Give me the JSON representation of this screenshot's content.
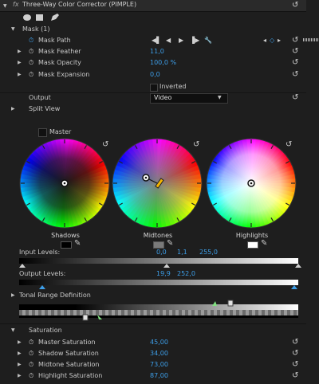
{
  "effect": {
    "fx_label": "fx",
    "title": "Three-Way Color Corrector (PIMPLE)"
  },
  "mask": {
    "group_label": "Mask (1)",
    "path_label": "Mask Path",
    "feather_label": "Mask Feather",
    "feather_value": "11,0",
    "opacity_label": "Mask Opacity",
    "opacity_value": "100,0 %",
    "expansion_label": "Mask Expansion",
    "expansion_value": "0,0",
    "inverted_label": "Inverted"
  },
  "output": {
    "label": "Output",
    "selected": "Video"
  },
  "split_view_label": "Split View",
  "master_label": "Master",
  "wheels": {
    "shadows_label": "Shadows",
    "midtones_label": "Midtones",
    "highlights_label": "Highlights"
  },
  "input_levels": {
    "label": "Input Levels:",
    "black": "0,0",
    "gray": "1,1",
    "white": "255,0"
  },
  "output_levels": {
    "label": "Output Levels:",
    "black": "19,9",
    "white": "252,0"
  },
  "tonal_label": "Tonal Range Definition",
  "saturation": {
    "group_label": "Saturation",
    "master_label": "Master Saturation",
    "master_value": "45,00",
    "shadow_label": "Shadow Saturation",
    "shadow_value": "34,00",
    "midtone_label": "Midtone Saturation",
    "midtone_value": "73,00",
    "highlight_label": "Highlight Saturation",
    "highlight_value": "87,00"
  },
  "colors": {
    "accent": "#3d9ee8",
    "background": "#1e1e1e",
    "header": "#2a2a2a"
  }
}
